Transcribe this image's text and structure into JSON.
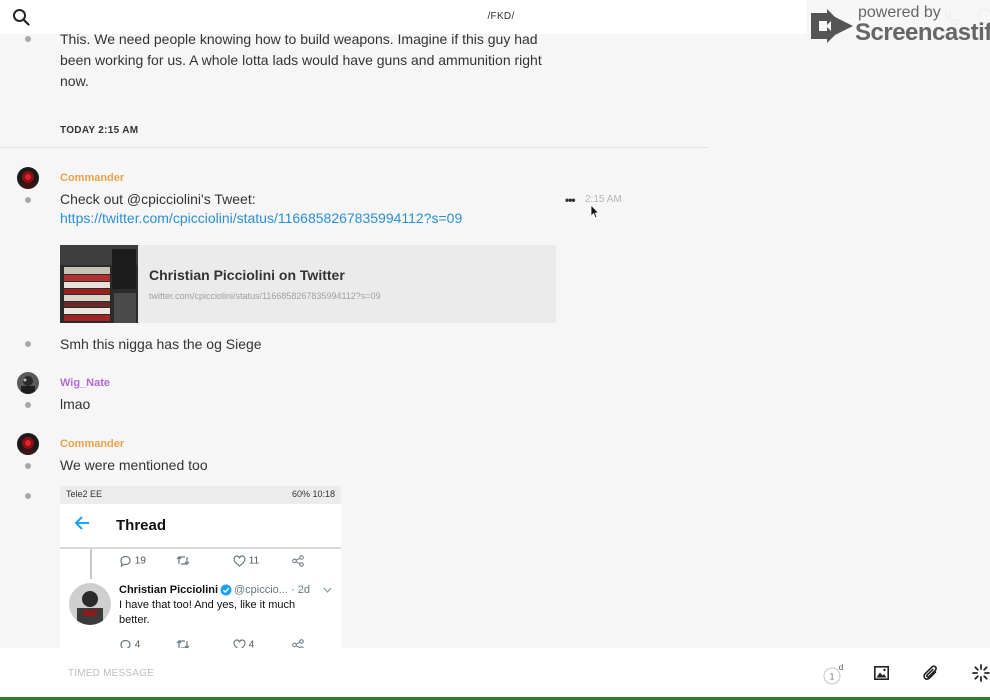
{
  "header": {
    "channel_title": "/FKD/"
  },
  "watermark": {
    "small_text": "powered by",
    "brand_text": "Screencastify"
  },
  "feed": {
    "first_message_lines": [
      "This. We need people knowing how to build weapons. Imagine if this guy had",
      "been working for us. A whole lotta lads would have guns and ammunition right",
      "now."
    ],
    "date_divider": "TODAY 2:15 AM",
    "messages": [
      {
        "author": "Commander",
        "author_color": "#e8a24a",
        "text": "Check out @cpicciolini's Tweet:",
        "link": "https://twitter.com/cpicciolini/status/1166858267835994112?s=09",
        "time": "2:15 AM",
        "preview": {
          "title": "Christian Picciolini on Twitter",
          "url": "twitter.com/cpicciolini/status/1166858267835994112?s=09"
        }
      },
      {
        "text": "Smh this nigga has the og Siege"
      },
      {
        "author": "Wig_Nate",
        "author_color": "#b36ad6",
        "text": "lmao"
      },
      {
        "author": "Commander",
        "author_color": "#e8a24a",
        "text": "We were mentioned too"
      }
    ],
    "screenshot": {
      "carrier": "Tele2 EE",
      "status_right": "60% 10:18",
      "title": "Thread",
      "top_actions": {
        "replies": "19",
        "likes": "11"
      },
      "tweet": {
        "name": "Christian Picciolini",
        "handle": "@cpiccio... · 2d",
        "text": "I have that too! And yes, like it much better.",
        "replies": "4",
        "likes": "4"
      }
    }
  },
  "composer": {
    "placeholder": "TIMED MESSAGE",
    "timer_value": "1",
    "timer_unit": "d"
  },
  "colors": {
    "link": "#2b8fd6",
    "accent_green": "#2e7d32"
  }
}
